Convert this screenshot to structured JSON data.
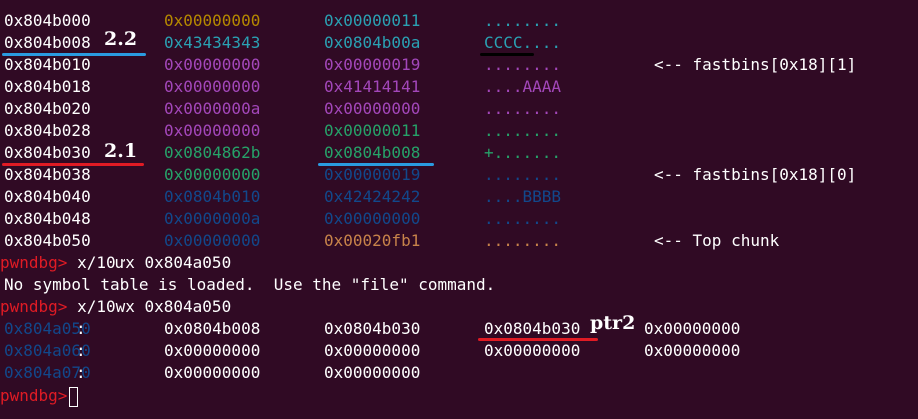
{
  "heap": {
    "rows": [
      {
        "addr": "0x804b000",
        "a": "0x00000000",
        "b": "0x00000011",
        "ascii": "........",
        "note": "",
        "ca": "#b58900",
        "cb": "#2aa1b3",
        "cc": "#2aa1b3"
      },
      {
        "addr": "0x804b008",
        "a": "0x43434343",
        "b": "0x0804b00a",
        "ascii": "CCCC....",
        "note": "",
        "ca": "#2aa1b3",
        "cb": "#2aa1b3",
        "cc": "#2aa1b3"
      },
      {
        "addr": "0x804b010",
        "a": "0x00000000",
        "b": "0x00000019",
        "ascii": "........",
        "note": "<-- fastbins[0x18][1]",
        "ca": "#a347ba",
        "cb": "#a347ba",
        "cc": "#a347ba"
      },
      {
        "addr": "0x804b018",
        "a": "0x00000000",
        "b": "0x41414141",
        "ascii": "....AAAA",
        "note": "",
        "ca": "#a347ba",
        "cb": "#a347ba",
        "cc": "#a347ba"
      },
      {
        "addr": "0x804b020",
        "a": "0x0000000a",
        "b": "0x00000000",
        "ascii": "........",
        "note": "",
        "ca": "#a347ba",
        "cb": "#a347ba",
        "cc": "#a347ba"
      },
      {
        "addr": "0x804b028",
        "a": "0x00000000",
        "b": "0x00000011",
        "ascii": "........",
        "note": "",
        "ca": "#a347ba",
        "cb": "#26a269",
        "cc": "#26a269"
      },
      {
        "addr": "0x804b030",
        "a": "0x0804862b",
        "b": "0x0804b008",
        "ascii": "+.......",
        "note": "",
        "ca": "#26a269",
        "cb": "#26a269",
        "cc": "#26a269"
      },
      {
        "addr": "0x804b038",
        "a": "0x00000000",
        "b": "0x00000019",
        "ascii": "........",
        "note": "<-- fastbins[0x18][0]",
        "ca": "#26a269",
        "cb": "#12488b",
        "cc": "#12488b"
      },
      {
        "addr": "0x804b040",
        "a": "0x0804b010",
        "b": "0x42424242",
        "ascii": "....BBBB",
        "note": "",
        "ca": "#12488b",
        "cb": "#12488b",
        "cc": "#12488b"
      },
      {
        "addr": "0x804b048",
        "a": "0x0000000a",
        "b": "0x00000000",
        "ascii": "........",
        "note": "",
        "ca": "#12488b",
        "cb": "#12488b",
        "cc": "#12488b"
      },
      {
        "addr": "0x804b050",
        "a": "0x00000000",
        "b": "0x00020fb1",
        "ascii": "........",
        "note": "<-- Top chunk",
        "ca": "#12488b",
        "cb": "#c7834a",
        "cc": "#c7834a"
      }
    ]
  },
  "prompt": "pwndbg>",
  "cmd1": " x/10ưx 0x804a050",
  "msg": "No symbol table is loaded.  Use the \"file\" command.",
  "cmd2": " x/10wx 0x804a050",
  "mem": {
    "rows": [
      {
        "addr": "0x804a050",
        "vals": [
          "0x0804b008",
          "0x0804b030",
          "0x0804b030",
          "0x00000000"
        ]
      },
      {
        "addr": "0x804a060",
        "vals": [
          "0x00000000",
          "0x00000000",
          "0x00000000",
          "0x00000000"
        ]
      },
      {
        "addr": "0x804a070",
        "vals": [
          "0x00000000",
          "0x00000000"
        ]
      }
    ]
  },
  "colon": ":",
  "annotations": {
    "a22": "2.2",
    "a21": "2.1",
    "ptr2": "ptr2"
  },
  "colors": {
    "bg": "#300a24",
    "prompt": "#e01b24",
    "blue_line": "#2a9be0",
    "red_line": "#e01b24",
    "black_line": "#000000",
    "addr_blue": "#12488b"
  }
}
